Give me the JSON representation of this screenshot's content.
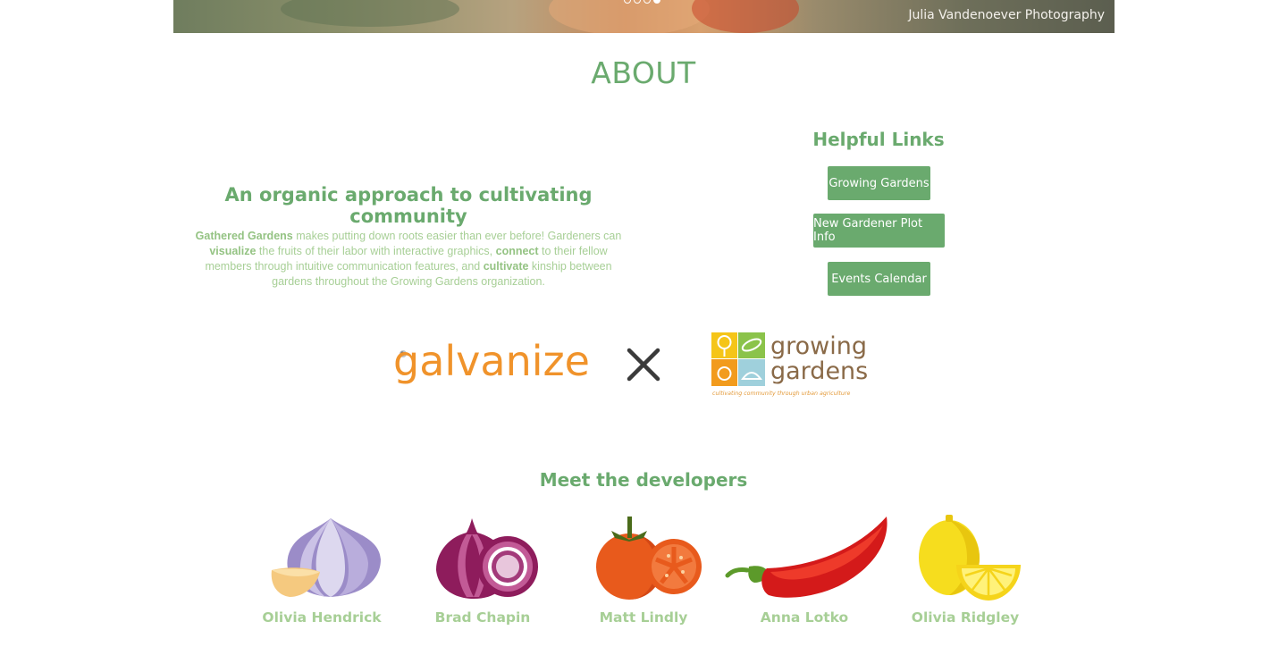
{
  "hero": {
    "credit": "Julia Vandenoever Photography",
    "carousel_dots": 4,
    "active_dot": 4
  },
  "about": {
    "title": "ABOUT",
    "tagline": "An organic approach to cultivating community",
    "blurb": {
      "brand": "Gathered Gardens",
      "part1": " makes putting down roots easier than ever before! Gardeners can ",
      "visualize": "visualize",
      "part2": " the fruits of their labor with interactive graphics, ",
      "connect": "connect",
      "part3": " to their fellow members through intuitive communication features, and ",
      "cultivate": "cultivate",
      "part4": " kinship between gardens throughout the Growing Gardens organization."
    }
  },
  "helpful_links": {
    "title": "Helpful Links",
    "buttons": [
      "Growing Gardens",
      "New Gardener Plot Info",
      "Events Calendar"
    ]
  },
  "partners": {
    "galvanize": "galvanize",
    "growing_gardens_line1": "growing",
    "growing_gardens_line2": "gardens",
    "growing_gardens_tagline": "cultivating community through urban agriculture"
  },
  "developers": {
    "title": "Meet the developers",
    "people": [
      {
        "name": "Olivia Hendrick",
        "icon": "garlic-icon"
      },
      {
        "name": "Brad Chapin",
        "icon": "red-onion-icon"
      },
      {
        "name": "Matt Lindly",
        "icon": "tomato-icon"
      },
      {
        "name": "Anna Lotko",
        "icon": "chili-pepper-icon"
      },
      {
        "name": "Olivia Ridgley",
        "icon": "lemon-icon"
      }
    ]
  },
  "colors": {
    "accent_green": "#6aaa6e",
    "light_green": "#a7cf96",
    "galvanize_orange": "#f0932b",
    "gg_brown": "#8a6a48"
  }
}
